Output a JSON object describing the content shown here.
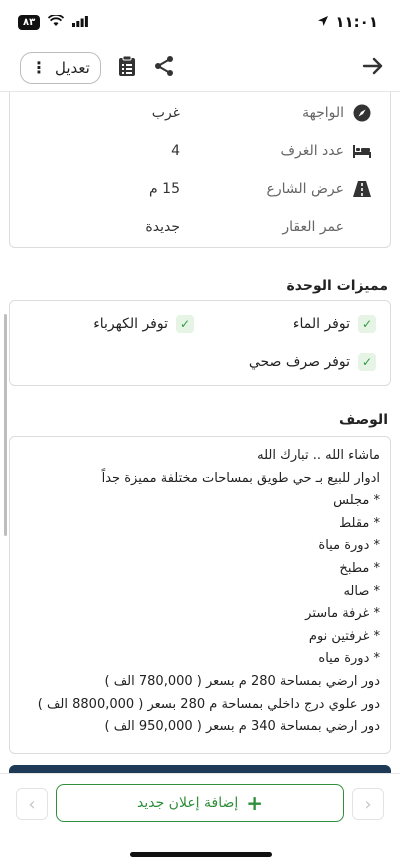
{
  "status_bar": {
    "time": "١١:٠١",
    "battery": "٨٣"
  },
  "header": {
    "edit_label": "تعديل",
    "icons": [
      "dots-vertical-icon",
      "clipboard-icon",
      "share-icon",
      "arrow-right-icon"
    ]
  },
  "specs": [
    {
      "label": "الواجهة",
      "value": "غرب",
      "icon": "compass-icon"
    },
    {
      "label": "عدد الغرف",
      "value": "4",
      "icon": "bed-icon"
    },
    {
      "label": "عرض الشارع",
      "value": "15 م",
      "icon": "road-icon"
    },
    {
      "label": "عمر العقار",
      "value": "جديدة",
      "icon": ""
    }
  ],
  "features": {
    "title": "مميزات الوحدة",
    "items": [
      "توفر الماء",
      "توفر الكهرباء",
      "توفر صرف صحي"
    ]
  },
  "description": {
    "title": "الوصف",
    "lines": [
      "ماشاء الله .. تبارك الله",
      "ادوار للبيع بـ حي طويق بمساحات مختلفة مميزة جداً",
      "* مجلس",
      "* مقلط",
      "* دورة مياة",
      "* مطبخ",
      "* صاله",
      "* غرفة ماستر",
      "* غرفتين نوم",
      "* دورة مياه",
      "دور ارضي بمساحة 280 م بسعر ( 780,000 الف )",
      "دور علوي درج داخلي بمساحة م 280 بسعر ( 8800,000 الف )",
      "دور ارضي بمساحة 340 م بسعر ( 950,000 الف )"
    ]
  },
  "bottom": {
    "add_label": "إضافة إعلان جديد"
  }
}
